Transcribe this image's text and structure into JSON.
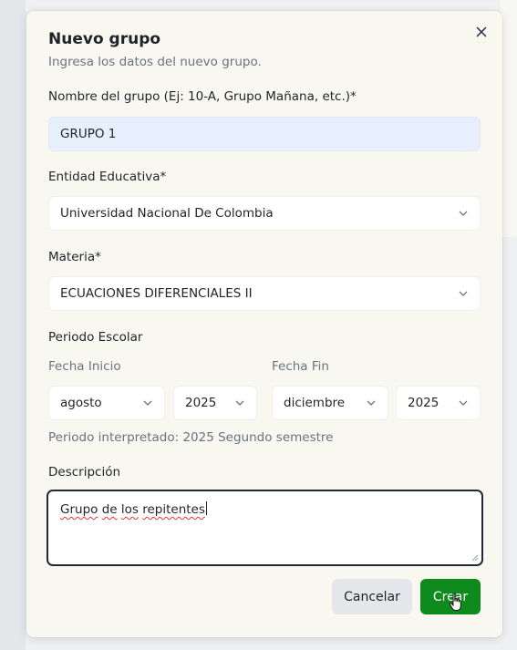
{
  "dialog": {
    "title": "Nuevo grupo",
    "subtitle": "Ingresa los datos del nuevo grupo.",
    "close_icon": "close-icon"
  },
  "fields": {
    "group_name": {
      "label": "Nombre del grupo (Ej: 10-A, Grupo Mañana, etc.)*",
      "value": "GRUPO 1"
    },
    "entity": {
      "label": "Entidad Educativa*",
      "value": "Universidad Nacional De Colombia"
    },
    "subject": {
      "label": "Materia*",
      "value": "ECUACIONES DIFERENCIALES II"
    },
    "period": {
      "label": "Periodo Escolar",
      "start_label": "Fecha Inicio",
      "end_label": "Fecha Fin",
      "start_month": "agosto",
      "start_year": "2025",
      "end_month": "diciembre",
      "end_year": "2025",
      "hint": "Periodo interpretado: 2025 Segundo semestre"
    },
    "description": {
      "label": "Descripción",
      "words": [
        "Grupo",
        "de",
        "los",
        "repitentes"
      ]
    }
  },
  "actions": {
    "cancel": "Cancelar",
    "create": "Crear"
  },
  "colors": {
    "primary": "#0f8a1c",
    "input_filled": "#e8effc",
    "dialog_bg": "#f8f8f1"
  }
}
